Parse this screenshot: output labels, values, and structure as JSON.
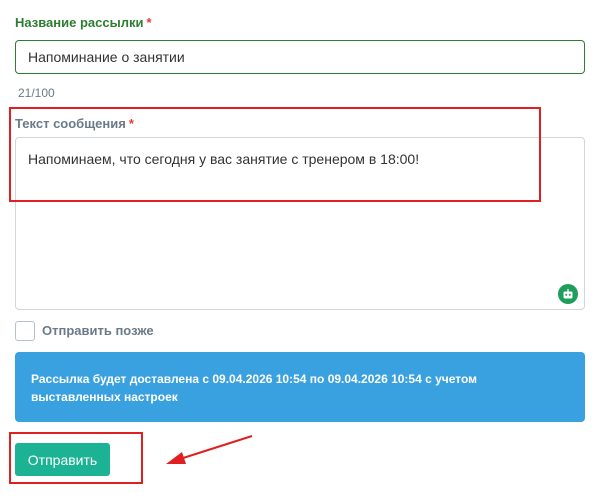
{
  "form": {
    "name_label": "Название рассылки",
    "required_mark": "*",
    "name_value": "Напоминание о занятии",
    "counter": "21/100",
    "message_label": "Текст сообщения",
    "message_value": "Напоминаем, что сегодня у вас занятие с тренером в 18:00!",
    "send_later_label": "Отправить позже",
    "send_later_checked": false,
    "info_text": "Рассылка будет доставлена с 09.04.2026 10:54 по 09.04.2026 10:54 с учетом выставленных настроек",
    "send_button": "Отправить"
  },
  "icons": {
    "textarea_corner": "robot-icon",
    "annotation": "arrow-icon"
  },
  "colors": {
    "label_green": "#2e7d32",
    "label_gray": "#6b7a88",
    "required_red": "#e53935",
    "info_blue": "#3aa1e0",
    "button_green": "#1bb394",
    "highlight_red": "#e02020"
  }
}
